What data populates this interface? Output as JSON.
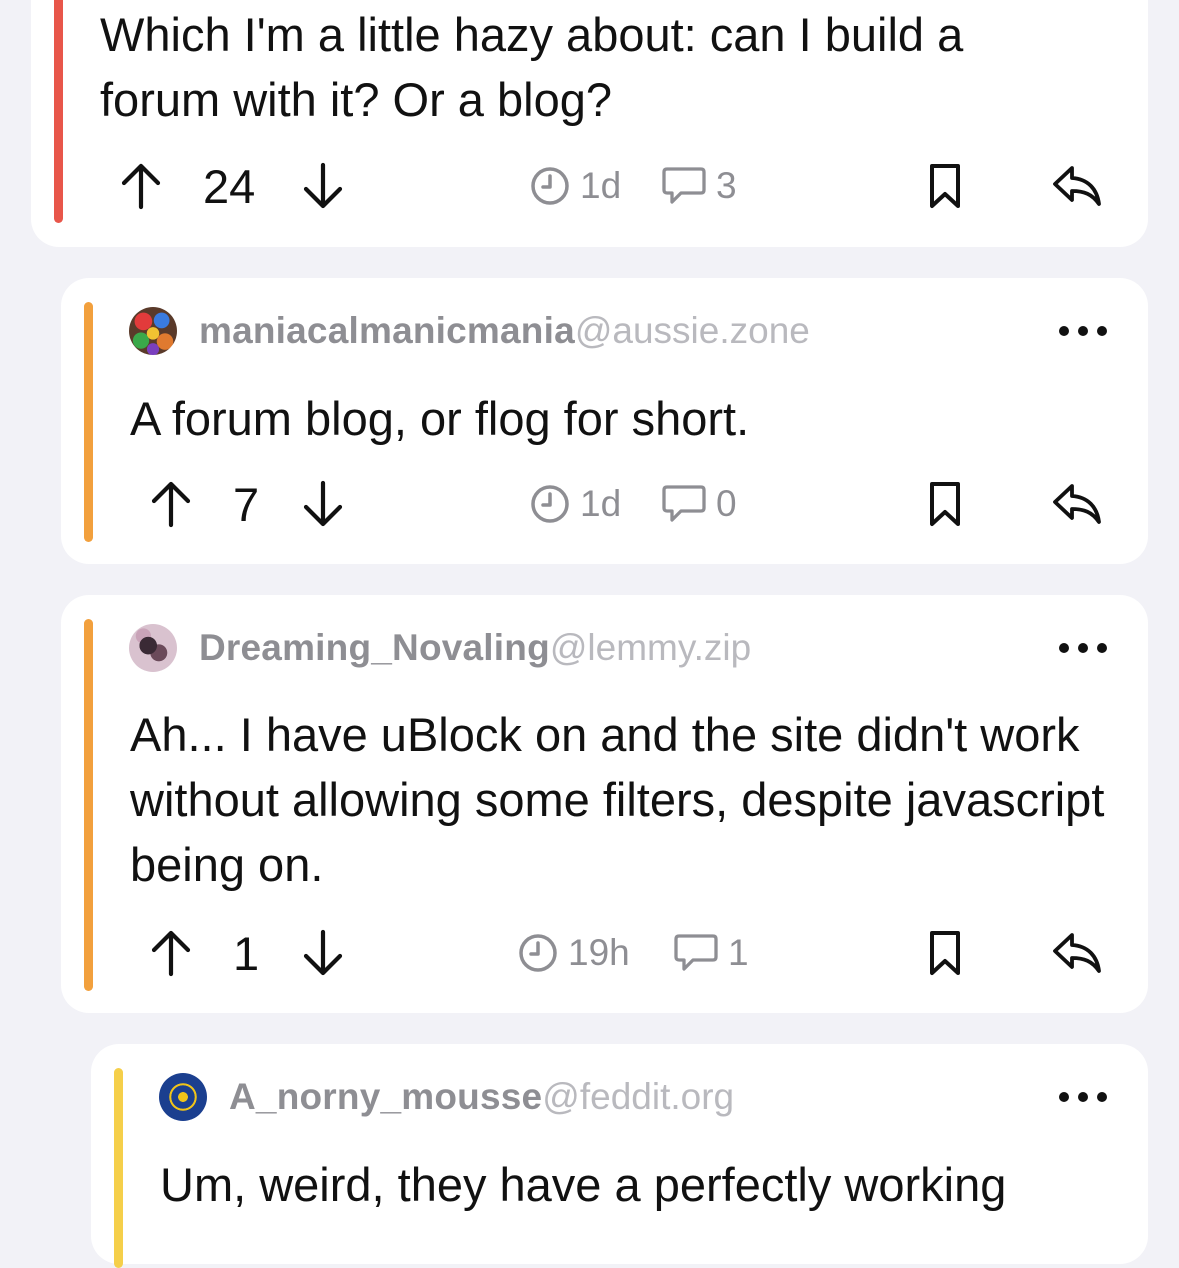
{
  "comments": [
    {
      "text": "Which I'm a little hazy about: can I build a forum with it? Or a blog?",
      "score": "24",
      "age": "1d",
      "replies": "3",
      "bar_color": "#e8564a"
    },
    {
      "username": "maniacalmanicmania",
      "instance": "@aussie.zone",
      "text": "A forum blog, or flog for short.",
      "score": "7",
      "age": "1d",
      "replies": "0",
      "bar_color": "#f2a03d"
    },
    {
      "username": "Dreaming_Novaling",
      "instance": "@lemmy.zip",
      "text": "Ah... I have uBlock on and the site didn't work without allowing some filters, despite javascript being on.",
      "score": "1",
      "age": "19h",
      "replies": "1",
      "bar_color": "#f2a03d"
    },
    {
      "username": "A_norny_mousse",
      "instance": "@feddit.org",
      "text": "Um, weird, they have a perfectly working",
      "bar_color": "#f5cf4a"
    }
  ],
  "icons": {
    "upvote": "arrow-up-icon",
    "downvote": "arrow-down-icon",
    "age": "clock-icon",
    "replies": "speech-bubble-icon",
    "save": "bookmark-icon",
    "reply": "reply-icon",
    "more": "ellipsis-icon"
  }
}
